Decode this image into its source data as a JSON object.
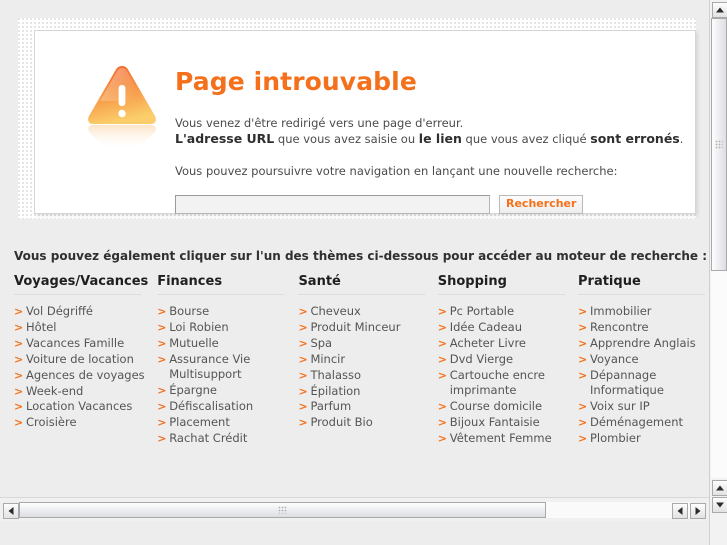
{
  "error": {
    "icon": "warning-triangle-icon",
    "title": "Page introuvable",
    "line1": "Vous venez d'être redirigé vers une page d'erreur.",
    "line2_a": "L'adresse URL",
    "line2_b": " que vous avez saisie ou ",
    "line2_c": "le lien",
    "line2_d": " que vous avez cliqué ",
    "line2_e": "sont erronés",
    "line2_f": ".",
    "line3": "Vous pouvez poursuivre votre navigation en lançant une nouvelle recherche:",
    "search_value": "",
    "search_placeholder": "",
    "search_button": "Rechercher"
  },
  "themes": {
    "heading": "Vous pouvez également cliquer sur l'un des thèmes ci-dessous pour accéder au moteur de recherche :",
    "arrow": ">",
    "columns": [
      {
        "title": "Voyages/Vacances",
        "links": [
          "Vol Dégriffé",
          "Hôtel",
          "Vacances Famille",
          "Voiture de location",
          "Agences de voyages",
          "Week-end",
          "Location Vacances",
          "Croisière"
        ]
      },
      {
        "title": "Finances",
        "links": [
          "Bourse",
          "Loi Robien",
          "Mutuelle",
          "Assurance Vie Multisupport",
          "Épargne",
          "Défiscalisation",
          "Placement",
          "Rachat Crédit"
        ]
      },
      {
        "title": "Santé",
        "links": [
          "Cheveux",
          "Produit Minceur",
          "Spa",
          "Mincir",
          "Thalasso",
          "Épilation",
          "Parfum",
          "Produit Bio"
        ]
      },
      {
        "title": "Shopping",
        "links": [
          "Pc Portable",
          "Idée Cadeau",
          "Acheter Livre",
          "Dvd Vierge",
          "Cartouche encre imprimante",
          "Course domicile",
          "Bijoux Fantaisie",
          "Vêtement Femme"
        ]
      },
      {
        "title": "Pratique",
        "links": [
          "Immobilier",
          "Rencontre",
          "Apprendre Anglais",
          "Voyance",
          "Dépannage Informatique",
          "Voix sur IP",
          "Déménagement",
          "Plombier"
        ]
      }
    ]
  },
  "scrollbars": {
    "v_up": "▲",
    "v_down": "▼",
    "h_left": "◀",
    "h_right": "▶"
  },
  "colors": {
    "accent": "#f4701b",
    "title": "#f4701b",
    "link": "#555555",
    "heading": "#303030",
    "page_bg": "#ededed"
  }
}
